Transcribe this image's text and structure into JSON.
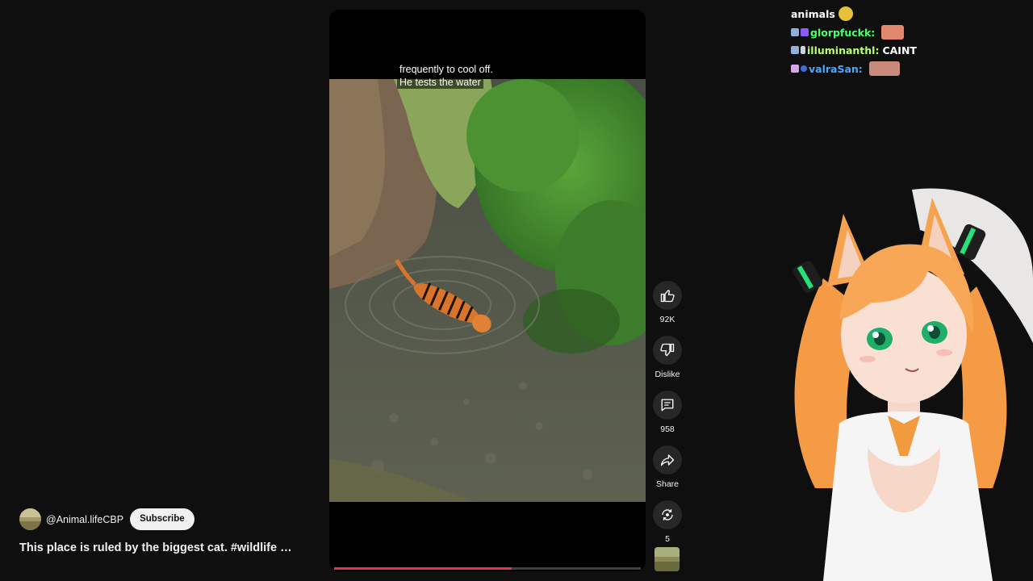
{
  "video": {
    "caption_lines": [
      "frequently to cool off.",
      "He tests the water"
    ],
    "progress_fraction": 0.58
  },
  "actions": {
    "like": {
      "icon": "thumbs-up-icon",
      "label": "92K"
    },
    "dislike": {
      "icon": "thumbs-down-icon",
      "label": "Dislike"
    },
    "comments": {
      "icon": "comment-icon",
      "label": "958"
    },
    "share": {
      "icon": "share-icon",
      "label": "Share"
    },
    "remix": {
      "icon": "remix-icon",
      "label": "5"
    }
  },
  "channel": {
    "handle": "@Animal.lifeCBP",
    "subscribe_label": "Subscribe"
  },
  "title": "This place is ruled by the biggest cat. #wildlife …",
  "chat": {
    "messages": [
      {
        "user": "",
        "text": "animals",
        "user_color": "#ffffff"
      },
      {
        "user": "glorpfuckk:",
        "text": "",
        "user_color": "#4dff6a"
      },
      {
        "user": "illuminanthl:",
        "text": "CAINT",
        "user_color": "#b7ff6e"
      },
      {
        "user": "valraSan:",
        "text": "",
        "user_color": "#4aa8ff"
      }
    ]
  },
  "colors": {
    "accent": "#e8324a",
    "background": "#0f0f0f",
    "button_bg": "#272727"
  }
}
